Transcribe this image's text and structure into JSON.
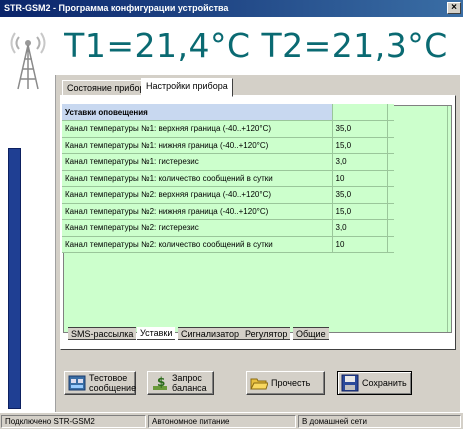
{
  "window": {
    "title": "STR-GSM2 - Программа конфигурации устройства",
    "close_label": "×"
  },
  "temperature_display": "T1=21,4°C T2=21,3°C",
  "tabs": [
    {
      "label": "Состояние прибора",
      "active": false
    },
    {
      "label": "Настройки прибора",
      "active": true
    }
  ],
  "settings": {
    "header": "Уставки оповещения",
    "rows": [
      {
        "label": "Канал температуры №1: верхняя граница (-40..+120°C)",
        "value": "35,0"
      },
      {
        "label": "Канал температуры №1: нижняя граница (-40..+120°C)",
        "value": "15,0"
      },
      {
        "label": "Канал температуры №1: гистерезис",
        "value": "3,0"
      },
      {
        "label": "Канал температуры №1: количество сообщений в сутки",
        "value": "10"
      },
      {
        "label": "Канал температуры №2: верхняя граница (-40..+120°C)",
        "value": "35,0"
      },
      {
        "label": "Канал температуры №2: нижняя граница (-40..+120°C)",
        "value": "15,0"
      },
      {
        "label": "Канал температуры №2: гистерезис",
        "value": "3,0"
      },
      {
        "label": "Канал температуры №2: количество сообщений в сутки",
        "value": "10"
      }
    ]
  },
  "bottom_tabs": [
    {
      "label": "SMS-рассылка",
      "active": false
    },
    {
      "label": "Уставки",
      "active": true
    },
    {
      "label": "Сигнализатор",
      "active": false
    },
    {
      "label": "Регулятор",
      "active": false
    },
    {
      "label": "Общие",
      "active": false
    }
  ],
  "buttons": {
    "test_message": "Тестовое сообщение",
    "balance_request": "Запрос баланса",
    "read": "Прочесть",
    "save": "Сохранить"
  },
  "icons": {
    "antenna": "antenna-icon",
    "test_message": "message-icon",
    "balance_request": "money-icon",
    "read": "open-folder-icon",
    "save": "floppy-disk-icon"
  },
  "status_bar": {
    "connection": "Подключено STR-GSM2",
    "power": "Автономное питание",
    "network": "В домашней сети"
  },
  "colors": {
    "title_bar": "#0a246a",
    "temperature_text": "#0a6a72",
    "grid_background": "#ccffcc",
    "grid_header": "#c8d8f0",
    "side_bar": "#1f3f93"
  }
}
